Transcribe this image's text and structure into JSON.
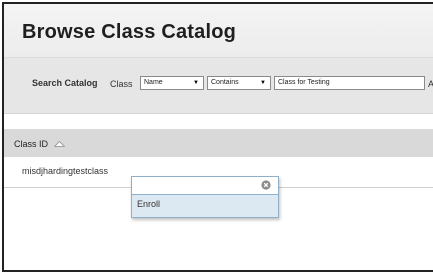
{
  "page": {
    "title": "Browse Class Catalog"
  },
  "search": {
    "label": "Search Catalog",
    "field_label": "Class",
    "field_select": "Name",
    "operator_select": "Contains",
    "query": "Class for Testing",
    "cut_text": "A"
  },
  "table": {
    "columns": [
      "Class ID"
    ],
    "rows": [
      {
        "class_id": "misdjhardingtestclass"
      }
    ]
  },
  "context_menu": {
    "items": [
      {
        "label": "Enroll"
      }
    ]
  },
  "colors": {
    "menu_bg": "#dde9f2",
    "menu_border": "#8fb0c8",
    "header_bg": "#d9d9d9",
    "search_bg": "#e6e6e6"
  }
}
